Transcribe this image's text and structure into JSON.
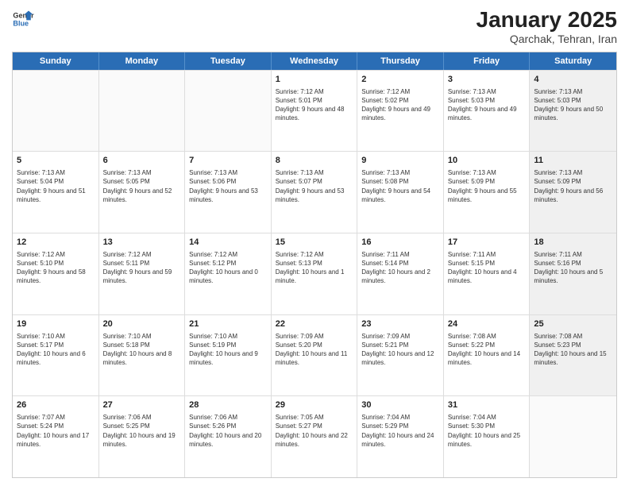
{
  "logo": {
    "general": "General",
    "blue": "Blue"
  },
  "title": "January 2025",
  "subtitle": "Qarchak, Tehran, Iran",
  "days": [
    "Sunday",
    "Monday",
    "Tuesday",
    "Wednesday",
    "Thursday",
    "Friday",
    "Saturday"
  ],
  "weeks": [
    [
      {
        "day": "",
        "text": "",
        "shaded": false,
        "empty": true
      },
      {
        "day": "",
        "text": "",
        "shaded": false,
        "empty": true
      },
      {
        "day": "",
        "text": "",
        "shaded": false,
        "empty": true
      },
      {
        "day": "1",
        "text": "Sunrise: 7:12 AM\nSunset: 5:01 PM\nDaylight: 9 hours and 48 minutes.",
        "shaded": false,
        "empty": false
      },
      {
        "day": "2",
        "text": "Sunrise: 7:12 AM\nSunset: 5:02 PM\nDaylight: 9 hours and 49 minutes.",
        "shaded": false,
        "empty": false
      },
      {
        "day": "3",
        "text": "Sunrise: 7:13 AM\nSunset: 5:03 PM\nDaylight: 9 hours and 49 minutes.",
        "shaded": false,
        "empty": false
      },
      {
        "day": "4",
        "text": "Sunrise: 7:13 AM\nSunset: 5:03 PM\nDaylight: 9 hours and 50 minutes.",
        "shaded": true,
        "empty": false
      }
    ],
    [
      {
        "day": "5",
        "text": "Sunrise: 7:13 AM\nSunset: 5:04 PM\nDaylight: 9 hours and 51 minutes.",
        "shaded": false,
        "empty": false
      },
      {
        "day": "6",
        "text": "Sunrise: 7:13 AM\nSunset: 5:05 PM\nDaylight: 9 hours and 52 minutes.",
        "shaded": false,
        "empty": false
      },
      {
        "day": "7",
        "text": "Sunrise: 7:13 AM\nSunset: 5:06 PM\nDaylight: 9 hours and 53 minutes.",
        "shaded": false,
        "empty": false
      },
      {
        "day": "8",
        "text": "Sunrise: 7:13 AM\nSunset: 5:07 PM\nDaylight: 9 hours and 53 minutes.",
        "shaded": false,
        "empty": false
      },
      {
        "day": "9",
        "text": "Sunrise: 7:13 AM\nSunset: 5:08 PM\nDaylight: 9 hours and 54 minutes.",
        "shaded": false,
        "empty": false
      },
      {
        "day": "10",
        "text": "Sunrise: 7:13 AM\nSunset: 5:09 PM\nDaylight: 9 hours and 55 minutes.",
        "shaded": false,
        "empty": false
      },
      {
        "day": "11",
        "text": "Sunrise: 7:13 AM\nSunset: 5:09 PM\nDaylight: 9 hours and 56 minutes.",
        "shaded": true,
        "empty": false
      }
    ],
    [
      {
        "day": "12",
        "text": "Sunrise: 7:12 AM\nSunset: 5:10 PM\nDaylight: 9 hours and 58 minutes.",
        "shaded": false,
        "empty": false
      },
      {
        "day": "13",
        "text": "Sunrise: 7:12 AM\nSunset: 5:11 PM\nDaylight: 9 hours and 59 minutes.",
        "shaded": false,
        "empty": false
      },
      {
        "day": "14",
        "text": "Sunrise: 7:12 AM\nSunset: 5:12 PM\nDaylight: 10 hours and 0 minutes.",
        "shaded": false,
        "empty": false
      },
      {
        "day": "15",
        "text": "Sunrise: 7:12 AM\nSunset: 5:13 PM\nDaylight: 10 hours and 1 minute.",
        "shaded": false,
        "empty": false
      },
      {
        "day": "16",
        "text": "Sunrise: 7:11 AM\nSunset: 5:14 PM\nDaylight: 10 hours and 2 minutes.",
        "shaded": false,
        "empty": false
      },
      {
        "day": "17",
        "text": "Sunrise: 7:11 AM\nSunset: 5:15 PM\nDaylight: 10 hours and 4 minutes.",
        "shaded": false,
        "empty": false
      },
      {
        "day": "18",
        "text": "Sunrise: 7:11 AM\nSunset: 5:16 PM\nDaylight: 10 hours and 5 minutes.",
        "shaded": true,
        "empty": false
      }
    ],
    [
      {
        "day": "19",
        "text": "Sunrise: 7:10 AM\nSunset: 5:17 PM\nDaylight: 10 hours and 6 minutes.",
        "shaded": false,
        "empty": false
      },
      {
        "day": "20",
        "text": "Sunrise: 7:10 AM\nSunset: 5:18 PM\nDaylight: 10 hours and 8 minutes.",
        "shaded": false,
        "empty": false
      },
      {
        "day": "21",
        "text": "Sunrise: 7:10 AM\nSunset: 5:19 PM\nDaylight: 10 hours and 9 minutes.",
        "shaded": false,
        "empty": false
      },
      {
        "day": "22",
        "text": "Sunrise: 7:09 AM\nSunset: 5:20 PM\nDaylight: 10 hours and 11 minutes.",
        "shaded": false,
        "empty": false
      },
      {
        "day": "23",
        "text": "Sunrise: 7:09 AM\nSunset: 5:21 PM\nDaylight: 10 hours and 12 minutes.",
        "shaded": false,
        "empty": false
      },
      {
        "day": "24",
        "text": "Sunrise: 7:08 AM\nSunset: 5:22 PM\nDaylight: 10 hours and 14 minutes.",
        "shaded": false,
        "empty": false
      },
      {
        "day": "25",
        "text": "Sunrise: 7:08 AM\nSunset: 5:23 PM\nDaylight: 10 hours and 15 minutes.",
        "shaded": true,
        "empty": false
      }
    ],
    [
      {
        "day": "26",
        "text": "Sunrise: 7:07 AM\nSunset: 5:24 PM\nDaylight: 10 hours and 17 minutes.",
        "shaded": false,
        "empty": false
      },
      {
        "day": "27",
        "text": "Sunrise: 7:06 AM\nSunset: 5:25 PM\nDaylight: 10 hours and 19 minutes.",
        "shaded": false,
        "empty": false
      },
      {
        "day": "28",
        "text": "Sunrise: 7:06 AM\nSunset: 5:26 PM\nDaylight: 10 hours and 20 minutes.",
        "shaded": false,
        "empty": false
      },
      {
        "day": "29",
        "text": "Sunrise: 7:05 AM\nSunset: 5:27 PM\nDaylight: 10 hours and 22 minutes.",
        "shaded": false,
        "empty": false
      },
      {
        "day": "30",
        "text": "Sunrise: 7:04 AM\nSunset: 5:29 PM\nDaylight: 10 hours and 24 minutes.",
        "shaded": false,
        "empty": false
      },
      {
        "day": "31",
        "text": "Sunrise: 7:04 AM\nSunset: 5:30 PM\nDaylight: 10 hours and 25 minutes.",
        "shaded": false,
        "empty": false
      },
      {
        "day": "",
        "text": "",
        "shaded": true,
        "empty": true
      }
    ]
  ]
}
